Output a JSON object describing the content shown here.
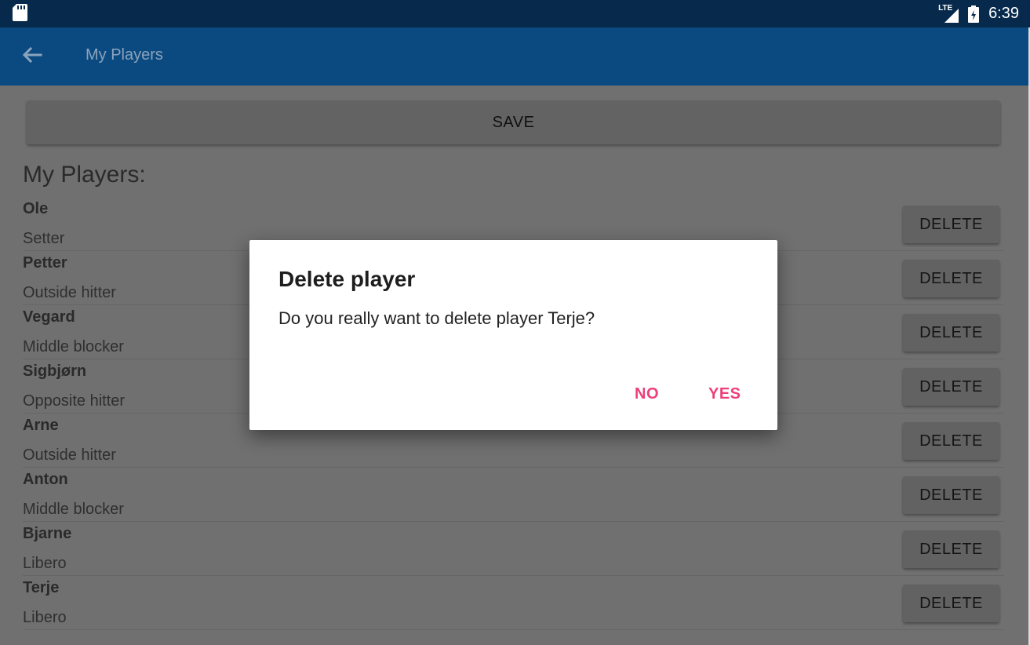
{
  "status_bar": {
    "time": "6:39",
    "network": "LTE",
    "icons": [
      "sd-card-icon",
      "signal-icon",
      "battery-icon"
    ]
  },
  "app_bar": {
    "title": "My Players",
    "back_icon": "arrow-back-icon"
  },
  "actions": {
    "save_label": "SAVE"
  },
  "list": {
    "heading": "My Players:",
    "delete_label": "DELETE",
    "players": [
      {
        "name": "Ole",
        "position": "Setter"
      },
      {
        "name": "Petter",
        "position": "Outside hitter"
      },
      {
        "name": "Vegard",
        "position": "Middle blocker"
      },
      {
        "name": "Sigbjørn",
        "position": "Opposite hitter"
      },
      {
        "name": "Arne",
        "position": "Outside hitter"
      },
      {
        "name": "Anton",
        "position": "Middle blocker"
      },
      {
        "name": "Bjarne",
        "position": "Libero"
      },
      {
        "name": "Terje",
        "position": "Libero"
      }
    ]
  },
  "dialog": {
    "title": "Delete player",
    "message": "Do you really want to delete player Terje?",
    "no_label": "NO",
    "yes_label": "YES"
  },
  "colors": {
    "status_bar": "#072a4c",
    "app_bar": "#0b4a80",
    "dialog_accent": "#ec407a",
    "scrim_background": "#707070"
  }
}
